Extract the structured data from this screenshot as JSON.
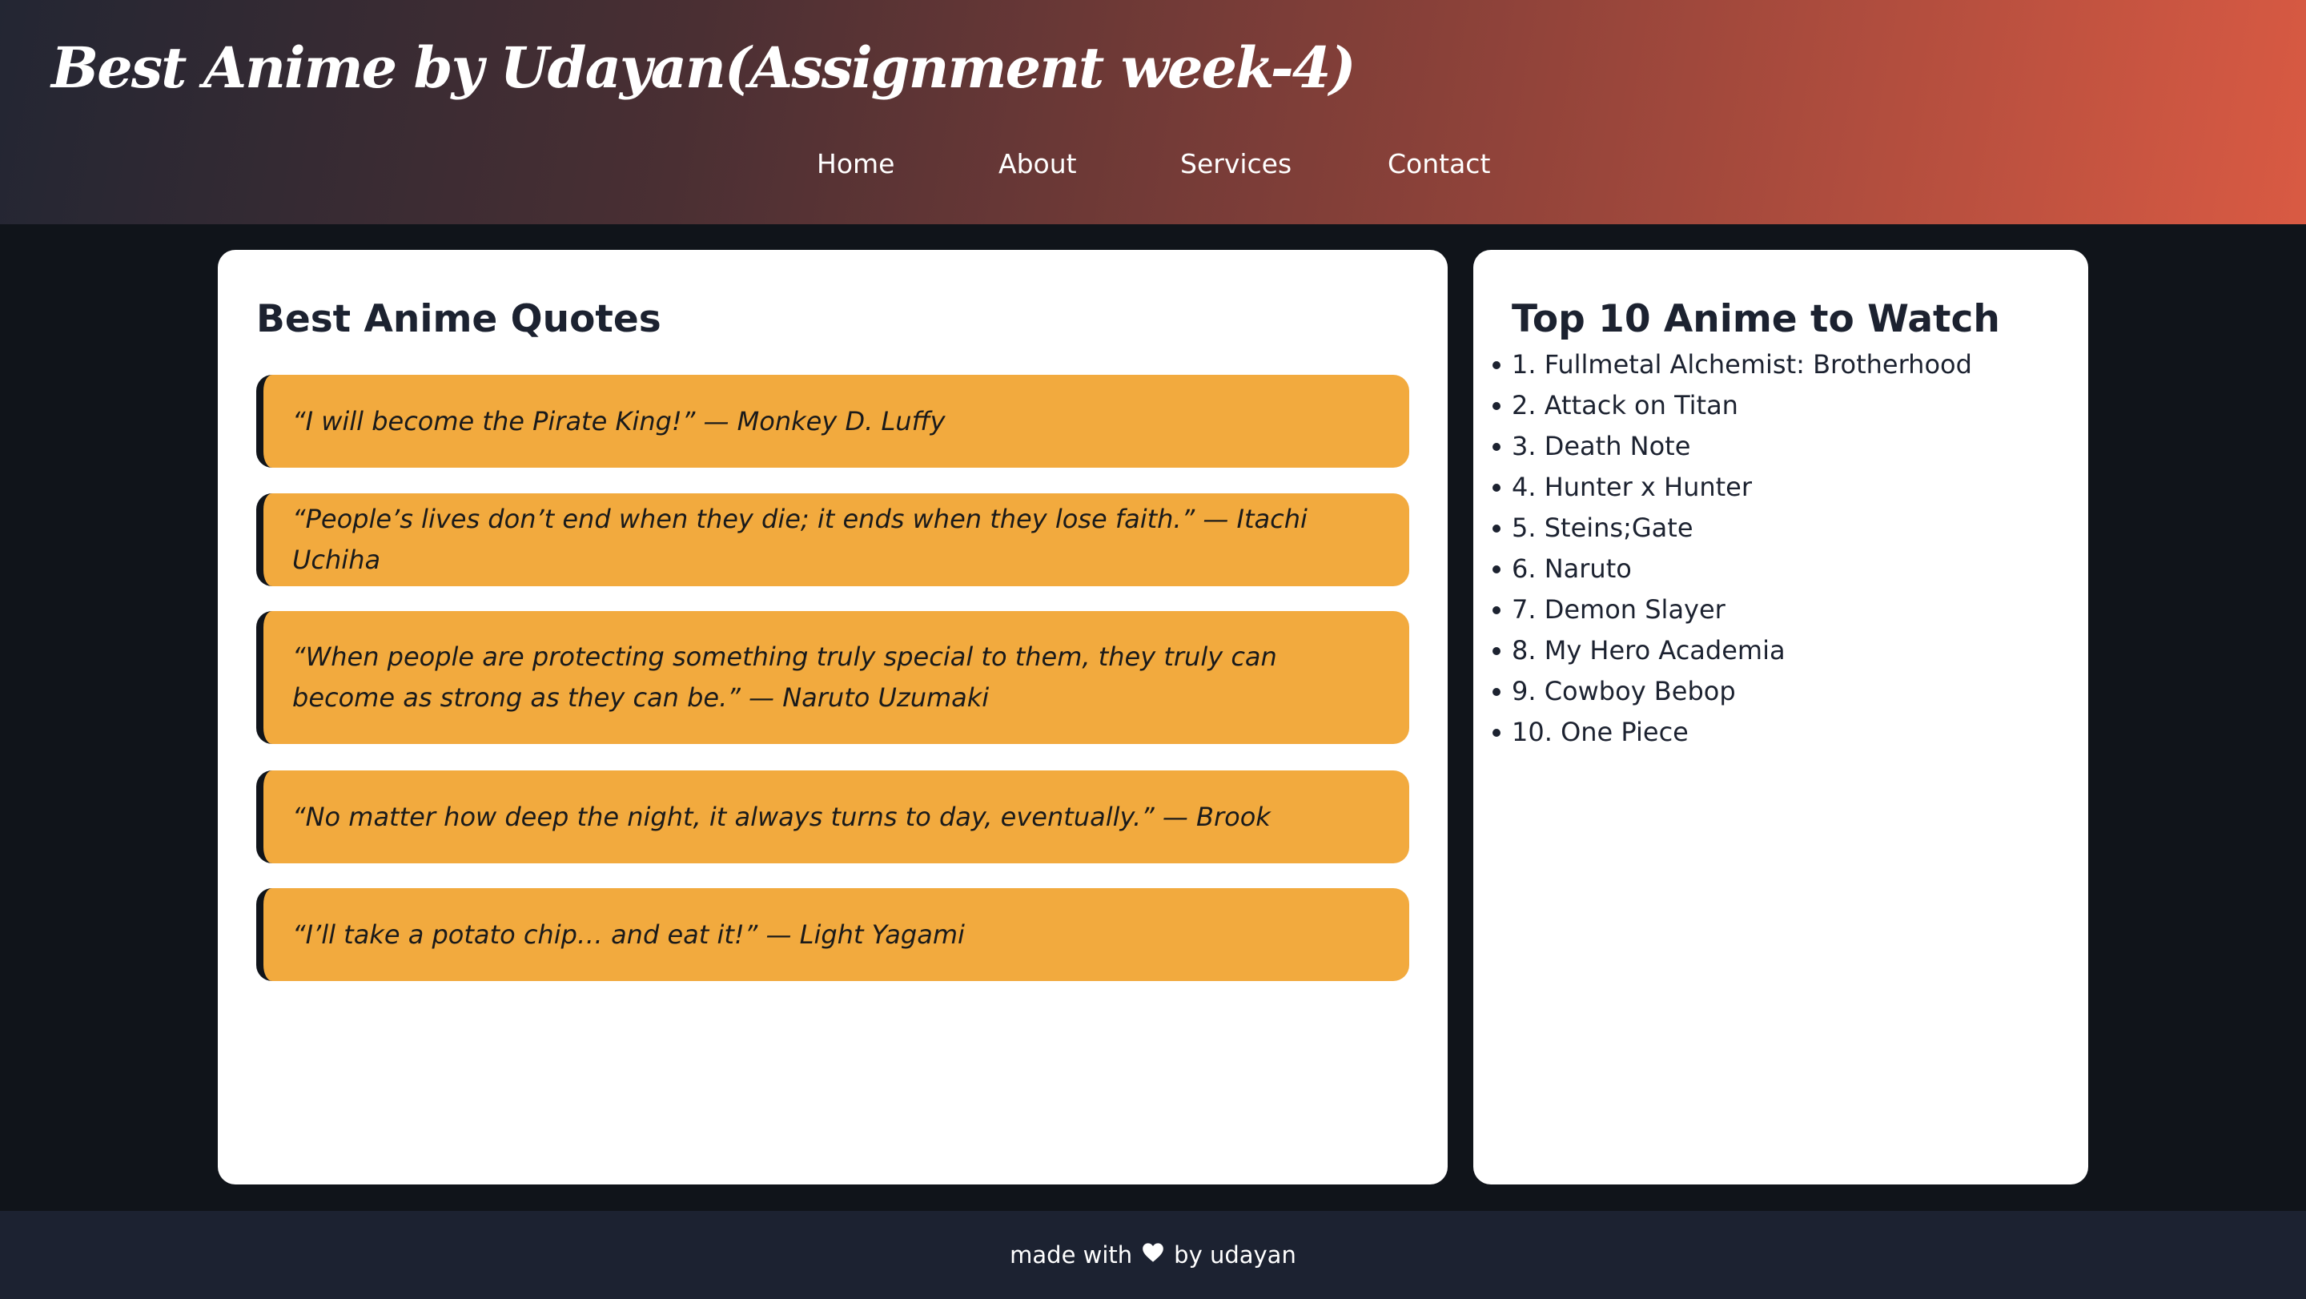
{
  "header": {
    "title": "Best Anime by Udayan(Assignment week-4)",
    "nav": [
      "Home",
      "About",
      "Services",
      "Contact"
    ],
    "gradient_colors": [
      "#232633",
      "#d95a43"
    ]
  },
  "quotes_card": {
    "title": "Best Anime Quotes",
    "quotes": [
      "“I will become the Pirate King!” — Monkey D. Luffy",
      "“People’s lives don’t end when they die; it ends when they lose faith.” — Itachi Uchiha",
      "“When people are protecting something truly special to them, they truly can become as strong as they can be.” — Naruto Uzumaki",
      "“No matter how deep the night, it always turns to day, eventually.” — Brook",
      "“I’ll take a potato chip… and eat it!” — Light Yagami"
    ],
    "quote_bg_color": "#f2aa3e"
  },
  "top10_card": {
    "title": "Top 10 Anime to Watch",
    "items": [
      "1. Fullmetal Alchemist: Brotherhood",
      "2. Attack on Titan",
      "3. Death Note",
      "4. Hunter x Hunter",
      "5. Steins;Gate",
      "6. Naruto",
      "7. Demon Slayer",
      "8. My Hero Academia",
      "9. Cowboy Bebop",
      "10. One Piece"
    ]
  },
  "footer": {
    "before": "made with",
    "heart_icon": "heart-icon",
    "after": "by udayan"
  }
}
